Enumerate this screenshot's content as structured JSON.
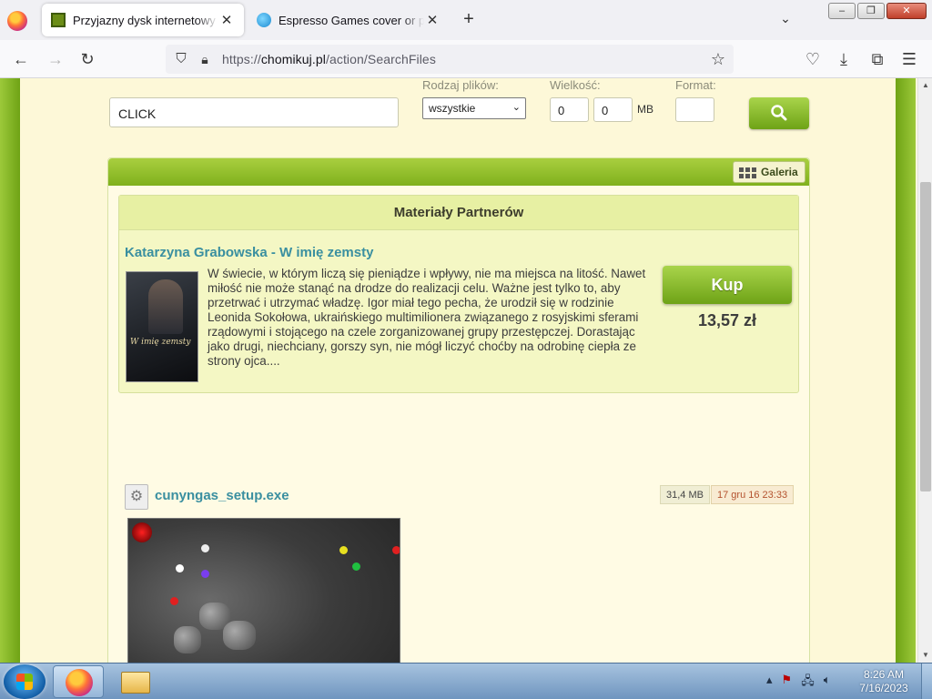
{
  "browser": {
    "tabs": [
      {
        "title": "Przyjazny dysk internetowy - Ch",
        "active": true
      },
      {
        "title": "Espresso Games cover or packa",
        "active": false
      }
    ],
    "url_prefix": "https://",
    "url_domain": "chomikuj.pl",
    "url_path": "/action/SearchFiles"
  },
  "search": {
    "query": "CLICK",
    "file_type_label": "Rodzaj plików:",
    "file_type_value": "wszystkie",
    "size_label": "Wielkość:",
    "size_min": "0",
    "size_max": "0",
    "size_unit": "MB",
    "format_label": "Format:",
    "format_value": ""
  },
  "results": {
    "gallery_label": "Galeria",
    "partner": {
      "heading": "Materiały Partnerów",
      "book_title": "Katarzyna Grabowska - W imię zemsty",
      "cover_text": "W imię zemsty",
      "description": "W świecie, w którym liczą się pieniądze i wpływy, nie ma miejsca na litość. Nawet miłość nie może stanąć na drodze do realizacji celu. Ważne jest tylko to, aby przetrwać i utrzymać władzę. Igor miał tego pecha, że urodził się w rodzinie Leonida Sokołowa, ukraińskiego multimilionera związanego z rosyjskimi sferami rządowymi i stojącego na czele zorganizowanej grupy przestępczej. Dorastając jako drugi, niechciany, gorszy syn, nie mógł liczyć choćby na odrobinę ciepła ze strony ojca....",
      "buy_label": "Kup",
      "price": "13,57 zł"
    },
    "file": {
      "name": "cunyngas_setup.exe",
      "size": "31,4 MB",
      "date": "17 gru 16 23:33"
    }
  },
  "taskbar": {
    "time": "8:26 AM",
    "date": "7/16/2023"
  }
}
